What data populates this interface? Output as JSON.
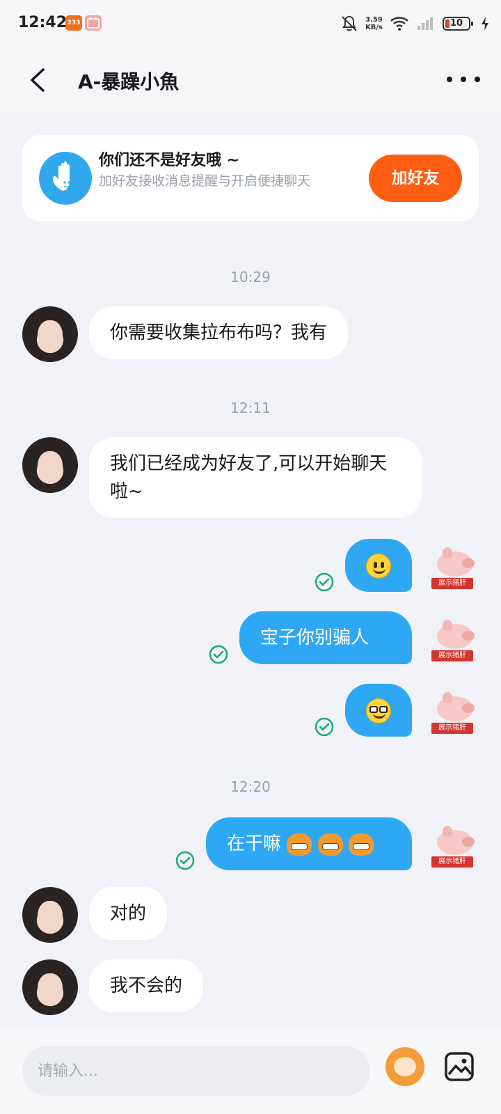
{
  "status_bar": {
    "time": "12:42",
    "app_badge_1": "233",
    "net_speed_value": "3.59",
    "net_speed_unit": "KB/s",
    "battery": "10"
  },
  "header": {
    "title": "A-暴躁小魚"
  },
  "friend_card": {
    "title": "你们还不是好友哦 ~",
    "description": "加好友接收消息提醒与开启便捷聊天",
    "button": "加好友"
  },
  "messages": {
    "ts1": "10:29",
    "m1": "你需要收集拉布布吗？我有",
    "ts2": "12:11",
    "m2": "我们已经成为好友了,可以开始聊天啦~",
    "m4": "宝子你别骗人",
    "ts3": "12:20",
    "m6": "在干嘛",
    "m7": "对的",
    "m8": "我不会的",
    "pig_label": "展示猪肝"
  },
  "input": {
    "placeholder": "请输入..."
  },
  "colors": {
    "accent_blue": "#2ea8f5",
    "add_friend_orange": "#ff5d12",
    "read_check_green": "#19a974"
  }
}
